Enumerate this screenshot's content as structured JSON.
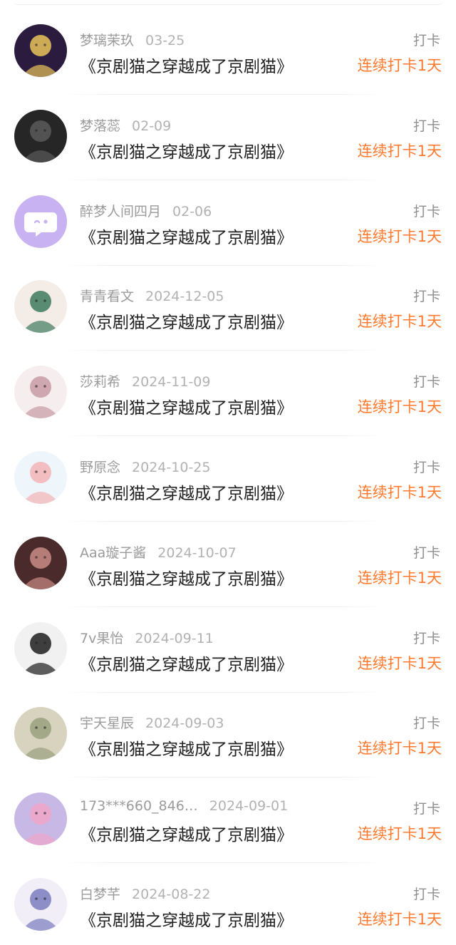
{
  "entries": [
    {
      "user": "梦璃茉玖",
      "date": "03-25",
      "book": "《京剧猫之穿越成了京剧猫》",
      "action": "打卡",
      "streak": "连续打卡1天",
      "avatar": {
        "bg": "#2b1b3e",
        "accent": "#e9c35a",
        "icon": "avatar-icon"
      }
    },
    {
      "user": "梦落蕊",
      "date": "02-09",
      "book": "《京剧猫之穿越成了京剧猫》",
      "action": "打卡",
      "streak": "连续打卡1天",
      "avatar": {
        "bg": "#262626",
        "accent": "#5a5a5a",
        "icon": "avatar-icon"
      }
    },
    {
      "user": "醉梦人间四月",
      "date": "02-06",
      "book": "《京剧猫之穿越成了京剧猫》",
      "action": "打卡",
      "streak": "连续打卡1天",
      "avatar": {
        "bg": "#c8b2f2",
        "accent": "#ffffff",
        "icon": "chat-bubble-icon"
      }
    },
    {
      "user": "青青看文",
      "date": "2024-12-05",
      "book": "《京剧猫之穿越成了京剧猫》",
      "action": "打卡",
      "streak": "连续打卡1天",
      "avatar": {
        "bg": "#f4ece6",
        "accent": "#3d7a5d",
        "icon": "avatar-icon"
      }
    },
    {
      "user": "莎莉希",
      "date": "2024-11-09",
      "book": "《京剧猫之穿越成了京剧猫》",
      "action": "打卡",
      "streak": "连续打卡1天",
      "avatar": {
        "bg": "#f6eeee",
        "accent": "#c89aa5",
        "icon": "avatar-icon"
      }
    },
    {
      "user": "野原念",
      "date": "2024-10-25",
      "book": "《京剧猫之穿越成了京剧猫》",
      "action": "打卡",
      "streak": "连续打卡1天",
      "avatar": {
        "bg": "#eef5fb",
        "accent": "#f2b4b4",
        "icon": "avatar-icon"
      }
    },
    {
      "user": "Aaa璇子酱",
      "date": "2024-10-07",
      "book": "《京剧猫之穿越成了京剧猫》",
      "action": "打卡",
      "streak": "连续打卡1天",
      "avatar": {
        "bg": "#4a2a2a",
        "accent": "#c98b86",
        "icon": "avatar-icon"
      }
    },
    {
      "user": "7v果怡",
      "date": "2024-09-11",
      "book": "《京剧猫之穿越成了京剧猫》",
      "action": "打卡",
      "streak": "连续打卡1天",
      "avatar": {
        "bg": "#f1f1f1",
        "accent": "#1e1e1e",
        "icon": "avatar-icon"
      }
    },
    {
      "user": "宇天星辰",
      "date": "2024-09-03",
      "book": "《京剧猫之穿越成了京剧猫》",
      "action": "打卡",
      "streak": "连续打卡1天",
      "avatar": {
        "bg": "#d8d3bf",
        "accent": "#9aa07e",
        "icon": "avatar-icon"
      }
    },
    {
      "user": "173***660_846…",
      "date": "2024-09-01",
      "book": "《京剧猫之穿越成了京剧猫》",
      "action": "打卡",
      "streak": "连续打卡1天",
      "avatar": {
        "bg": "#c7b8e6",
        "accent": "#f0a5c8",
        "icon": "avatar-icon"
      }
    },
    {
      "user": "白梦芊",
      "date": "2024-08-22",
      "book": "《京剧猫之穿越成了京剧猫》",
      "action": "打卡",
      "streak": "连续打卡1天",
      "avatar": {
        "bg": "#f1eef7",
        "accent": "#7b7bbf",
        "icon": "avatar-icon"
      }
    }
  ]
}
